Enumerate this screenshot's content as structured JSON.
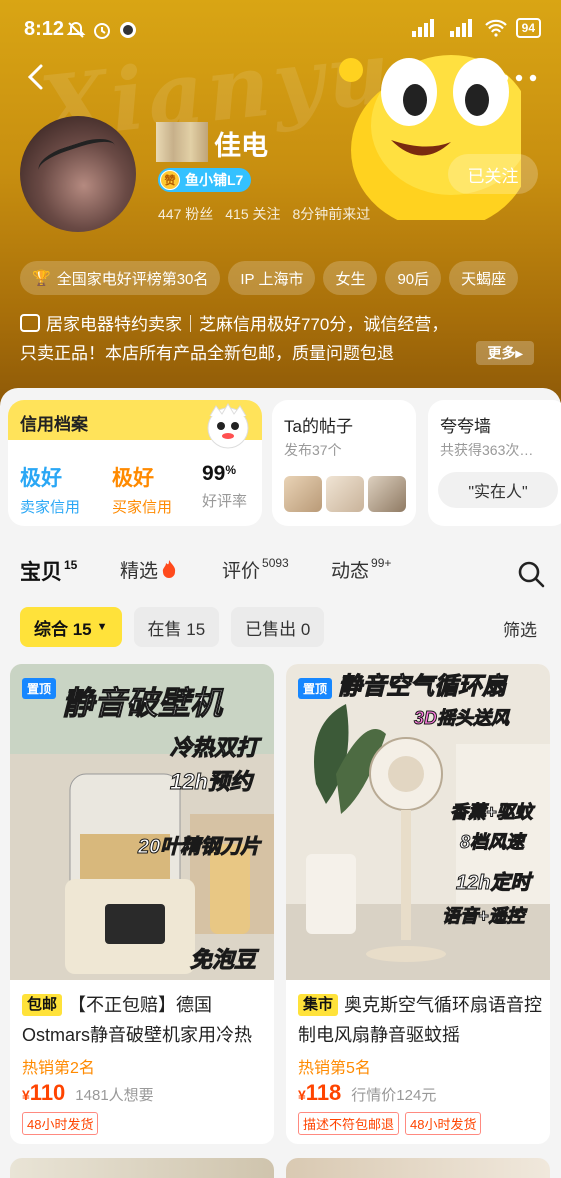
{
  "status_bar": {
    "time": "8:12",
    "battery": "94"
  },
  "header": {
    "watermark": "Xianyu",
    "shop_name": "佳电",
    "level_zan": "赞",
    "level_label": "鱼小铺L7",
    "follow_label": "已关注",
    "stats": [
      "447 粉丝",
      "415 关注",
      "8分钟前来过"
    ]
  },
  "tags": [
    "全国家电好评榜第30名",
    "IP 上海市",
    "女生",
    "90后",
    "天蝎座"
  ],
  "description": {
    "line1": "居家电器特约卖家｜芝麻信用极好770分，诚信经营，",
    "line2": "只卖正品！本店所有产品全新包邮，质量问题包退",
    "more": "更多"
  },
  "credit": {
    "title": "信用档案",
    "seller_value": "极好",
    "seller_label": "卖家信用",
    "buyer_value": "极好",
    "buyer_label": "买家信用",
    "rate_value": "99",
    "rate_unit": "%",
    "rate_label": "好评率"
  },
  "posts": {
    "title": "Ta的帖子",
    "sub": "发布37个"
  },
  "praise": {
    "title": "夸夸墙",
    "sub": "共获得363次…",
    "pill": "\"实在人\""
  },
  "tabs": [
    {
      "label": "宝贝",
      "count": "15"
    },
    {
      "label": "精选",
      "count": ""
    },
    {
      "label": "评价",
      "count": "5093"
    },
    {
      "label": "动态",
      "count": "99+"
    }
  ],
  "filters": {
    "sort": "综合 15",
    "on_sale": "在售 15",
    "sold": "已售出 0",
    "screen": "筛选"
  },
  "products": [
    {
      "pin": "置顶",
      "overlay": [
        "静音破壁机",
        "冷热双打",
        "12h预约",
        "20叶精钢刀片",
        "免泡豆"
      ],
      "tag": "包邮",
      "title": "【不正包赔】德国Ostmars静音破壁机家用冷热",
      "rank": "热销第2名",
      "currency": "¥",
      "price": "110",
      "meta": "1481人想要",
      "chips": [
        "48小时发货"
      ]
    },
    {
      "pin": "置顶",
      "overlay": [
        "静音空气循环扇",
        "3D摇头送风",
        "香薰+驱蚊",
        "8档风速",
        "12h定时",
        "语音+遥控"
      ],
      "tag": "集市",
      "title": "奥克斯空气循环扇语音控制电风扇静音驱蚊摇",
      "rank": "热销第5名",
      "currency": "¥",
      "price": "118",
      "meta": "行情价124元",
      "chips": [
        "描述不符包邮退",
        "48小时发货"
      ]
    }
  ],
  "colors": {
    "accent": "#ffe23a",
    "price": "#ff4400",
    "blue": "#1787ff",
    "credit_blue": "#2aa7f5",
    "credit_orange": "#ff8a00"
  }
}
